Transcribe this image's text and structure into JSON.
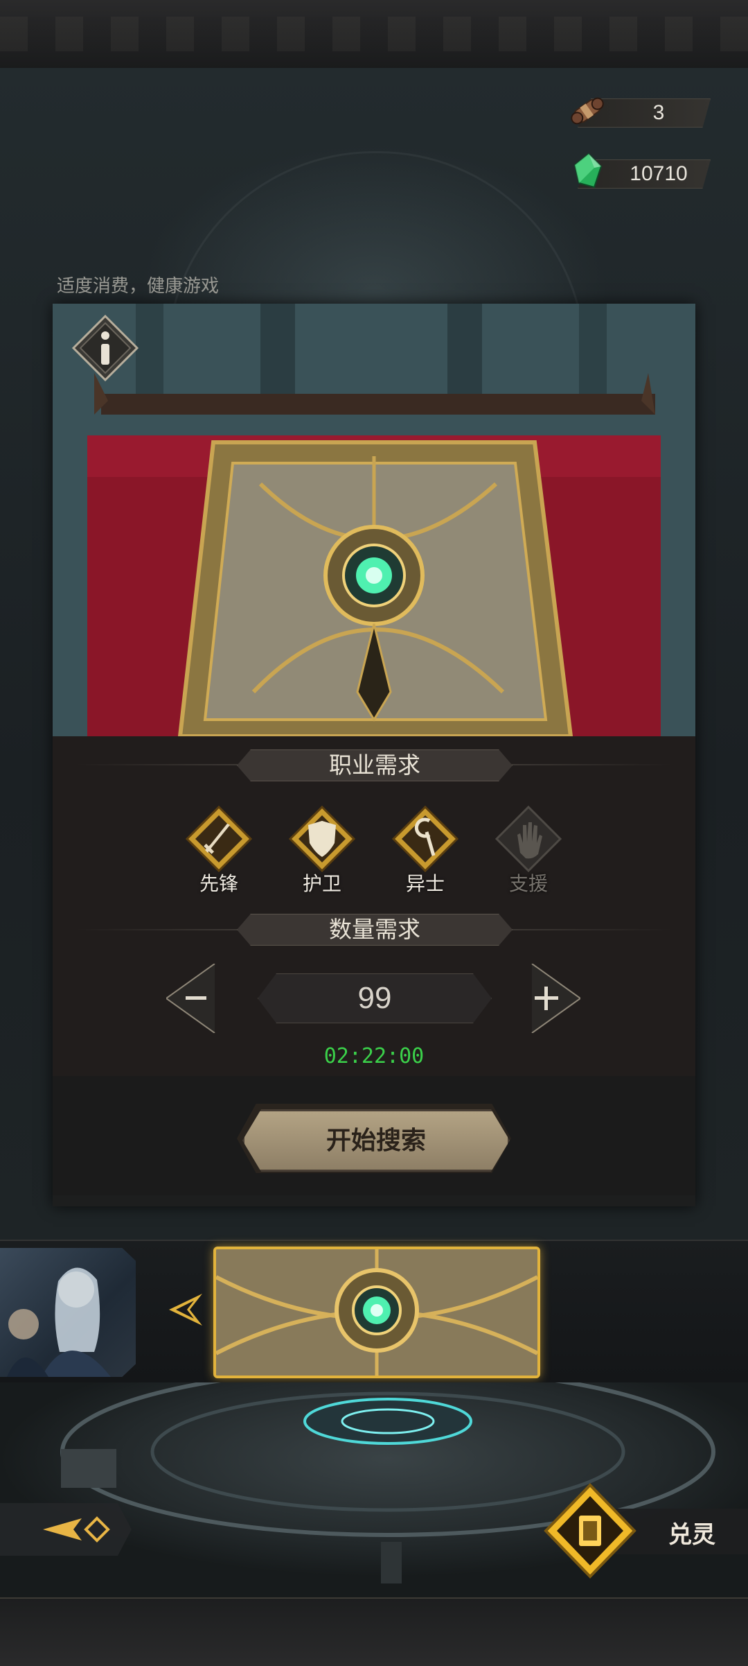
{
  "currencies": [
    {
      "icon": "scroll-icon",
      "value": "3"
    },
    {
      "icon": "green-crystal-icon",
      "value": "10710"
    }
  ],
  "tip": "适度消费，健康游戏",
  "requirements": {
    "class_title": "职业需求",
    "classes": [
      {
        "label": "先锋",
        "icon": "sword-icon",
        "active": true
      },
      {
        "label": "护卫",
        "icon": "shield-icon",
        "active": true
      },
      {
        "label": "异士",
        "icon": "staff-icon",
        "active": true
      },
      {
        "label": "支援",
        "icon": "hand-icon",
        "active": false
      }
    ],
    "quantity_title": "数量需求",
    "quantity": "99",
    "timer": "02:22:00"
  },
  "actions": {
    "start_search": "开始搜索",
    "exchange": "兑灵"
  },
  "colors": {
    "accent_gold": "#e2b33c",
    "timer_green": "#3bd14a"
  }
}
